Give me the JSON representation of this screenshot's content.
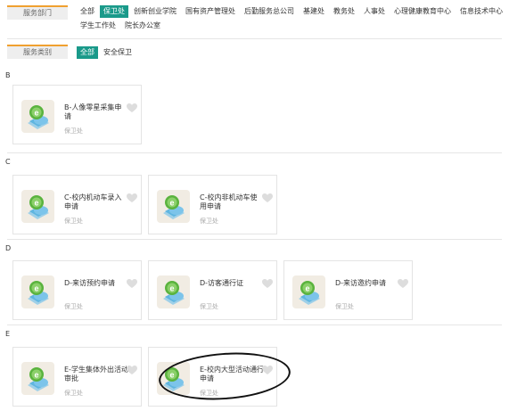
{
  "filters": {
    "department_label": "服务部门",
    "departments": [
      "全部",
      "保卫处",
      "创新创业学院",
      "国有资产管理处",
      "后勤服务总公司",
      "基建处",
      "教务处",
      "人事处",
      "心理健康教育中心",
      "信息技术中心",
      "学生工作处",
      "院长办公室"
    ],
    "department_selected": "保卫处",
    "category_label": "服务类别",
    "categories": [
      "全部",
      "安全保卫"
    ],
    "category_selected": "全部"
  },
  "sections": [
    {
      "letter": "B",
      "cards": [
        {
          "title": "B-人像零星采集申请",
          "dept": "保卫处"
        }
      ]
    },
    {
      "letter": "C",
      "cards": [
        {
          "title": "C-校内机动车录入申请",
          "dept": "保卫处"
        },
        {
          "title": "C-校内非机动车使用申请",
          "dept": "保卫处"
        }
      ]
    },
    {
      "letter": "D",
      "cards": [
        {
          "title": "D-来访预约申请",
          "dept": "保卫处"
        },
        {
          "title": "D-访客通行证",
          "dept": "保卫处"
        },
        {
          "title": "D-来访邀约申请",
          "dept": "保卫处"
        }
      ]
    },
    {
      "letter": "E",
      "cards": [
        {
          "title": "E-学生集体外出活动审批",
          "dept": "保卫处"
        },
        {
          "title": "E-校内大型活动通行申请",
          "dept": "保卫处"
        }
      ]
    }
  ],
  "icons": {
    "card_icon": "app-cloud-e-icon",
    "favorite": "heart-icon"
  },
  "colors": {
    "accent": "#1a9a8a",
    "label_bar": "#f0a030",
    "heart": "#dddddd"
  }
}
